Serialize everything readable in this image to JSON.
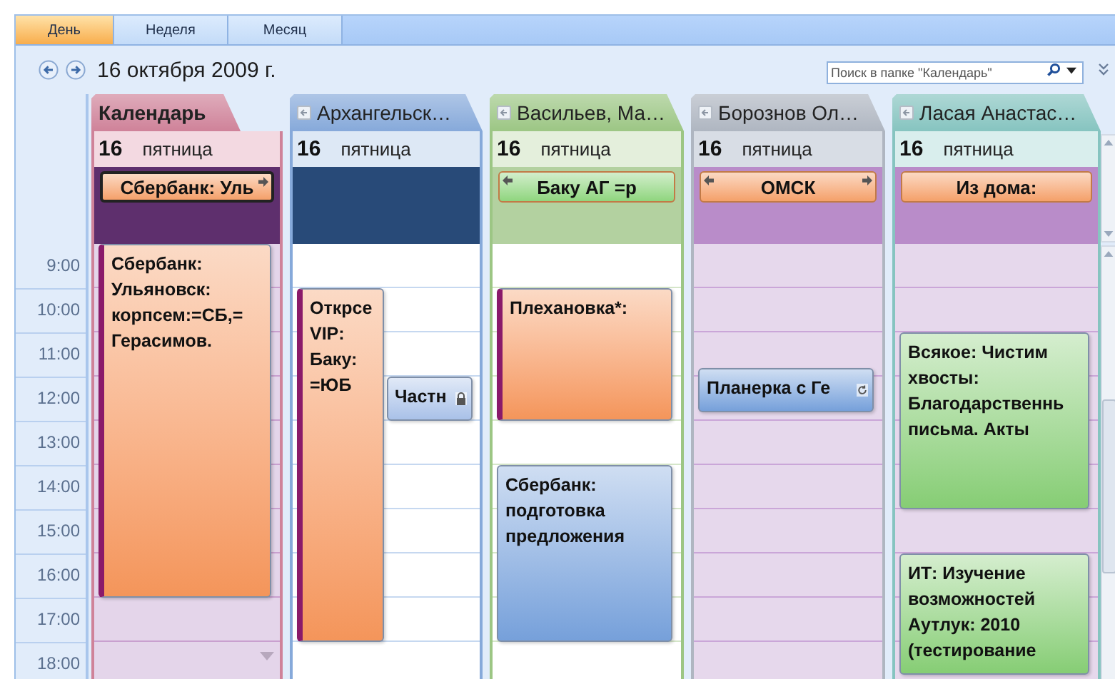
{
  "view_tabs": [
    {
      "label": "День",
      "selected": true
    },
    {
      "label": "Неделя",
      "selected": false
    },
    {
      "label": "Месяц",
      "selected": false
    }
  ],
  "date_title": "16 октября 2009 г.",
  "search": {
    "placeholder": "Поиск в папке \"Календарь\""
  },
  "hours": [
    "9:00",
    "10:00",
    "11:00",
    "12:00",
    "13:00",
    "14:00",
    "15:00",
    "16:00",
    "17:00",
    "18:00"
  ],
  "calendars": [
    {
      "title": "Календарь",
      "selected": true,
      "color": "#cf8299",
      "day_number": "16",
      "weekday": "пятница",
      "more_below": true,
      "all_day": [
        {
          "text": "Сбербанк: Уль",
          "color": "#f4a069",
          "selected": true,
          "continues_before": false,
          "continues_after": true
        }
      ],
      "events": [
        {
          "text": "Сбербанк: Ульяновск: корпсем:=СБ,= Герасимов.",
          "color": "#f4955a",
          "kind": "plain",
          "left_bar": true
        }
      ]
    },
    {
      "title": "Архангельск…",
      "selected": false,
      "color": "#86a9da",
      "day_number": "16",
      "weekday": "пятница",
      "more_below": false,
      "events": [
        {
          "text": "Открсе VIP: Баку: =ЮБ",
          "color": "#f4955a",
          "kind": "plain",
          "left_bar": true
        },
        {
          "text": "Частн",
          "color": "#a9c1e8",
          "kind": "private",
          "left_bar": false
        }
      ]
    },
    {
      "title": "Васильев, Ма…",
      "selected": false,
      "color": "#9cc684",
      "day_number": "16",
      "weekday": "пятница",
      "more_below": false,
      "all_day": [
        {
          "text": "Баку АГ =р",
          "color": "#8fd57e",
          "selected": false,
          "continues_before": true,
          "continues_after": false
        }
      ],
      "events": [
        {
          "text": "Плехановка*:",
          "color": "#f4955a",
          "kind": "plain",
          "left_bar": true
        },
        {
          "text": "Сбербанк: подготовка предложения",
          "color": "#76a0da",
          "kind": "plain",
          "left_bar": false
        }
      ]
    },
    {
      "title": "Борознов Ол…",
      "selected": false,
      "color": "#afb6c1",
      "day_number": "16",
      "weekday": "пятница",
      "more_below": false,
      "all_day": [
        {
          "text": "ОМСК",
          "color": "#f4a069",
          "selected": false,
          "continues_before": true,
          "continues_after": true
        }
      ],
      "events": [
        {
          "text": "Планерка с Ге",
          "color": "#76a0da",
          "kind": "recurring",
          "left_bar": false
        }
      ]
    },
    {
      "title": "Ласая Анастас…",
      "selected": false,
      "color": "#86c4c0",
      "day_number": "16",
      "weekday": "пятница",
      "more_below": false,
      "all_day": [
        {
          "text": "Из дома:",
          "color": "#f4a069",
          "selected": false,
          "continues_before": false,
          "continues_after": false
        }
      ],
      "events": [
        {
          "text": "Всякое: Чистим хвосты: Благодарственнь письма. Акты",
          "color": "#86cd74",
          "kind": "plain",
          "left_bar": false
        },
        {
          "text": "ИТ: Изучение возможностей Аутлук: 2010 (тестирование",
          "color": "#86cd74",
          "kind": "plain",
          "left_bar": false
        }
      ]
    }
  ]
}
